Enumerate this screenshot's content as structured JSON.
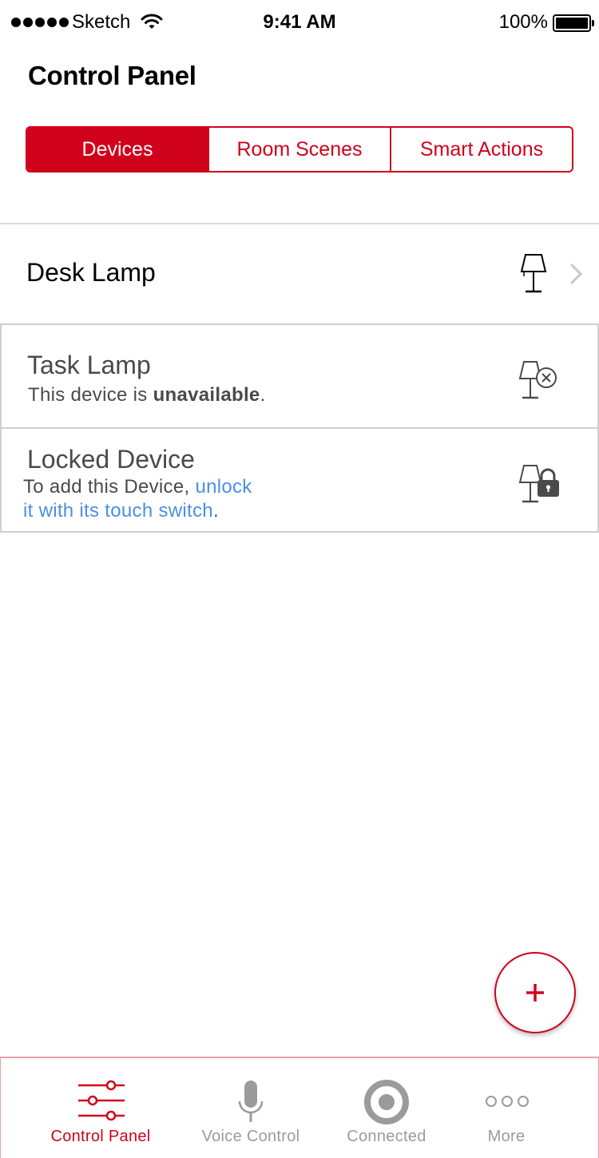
{
  "status_bar": {
    "carrier": "Sketch",
    "time": "9:41 AM",
    "battery": "100%"
  },
  "page": {
    "title": "Control Panel"
  },
  "segments": [
    {
      "label": "Devices",
      "active": true
    },
    {
      "label": "Room Scenes",
      "active": false
    },
    {
      "label": "Smart Actions",
      "active": false
    }
  ],
  "devices": [
    {
      "name": "Desk Lamp",
      "icon": "lamp-icon"
    },
    {
      "name": "Task Lamp",
      "status_prefix": "This device is ",
      "status_bold": "unavailable",
      "status_suffix": ".",
      "icon": "lamp-unavailable-icon"
    },
    {
      "name": "Locked Device",
      "hint_prefix": "To add this Device, ",
      "hint_link_1": "unlock",
      "hint_link_2": "it with its touch switch",
      "hint_suffix": ".",
      "icon": "lamp-locked-icon"
    }
  ],
  "fab": {
    "icon": "plus-icon"
  },
  "tabbar": {
    "items": [
      {
        "label": "Control Panel",
        "icon": "sliders-icon",
        "active": true
      },
      {
        "label": "Voice Control",
        "icon": "microphone-icon",
        "active": false
      },
      {
        "label": "Connected",
        "icon": "target-icon",
        "active": false
      },
      {
        "label": "More",
        "icon": "more-dots-icon",
        "active": false
      }
    ]
  },
  "colors": {
    "accent": "#d0021b",
    "link": "#4a90e2",
    "muted_text": "#4a4a4a",
    "inactive_tab": "#9b9b9b"
  }
}
